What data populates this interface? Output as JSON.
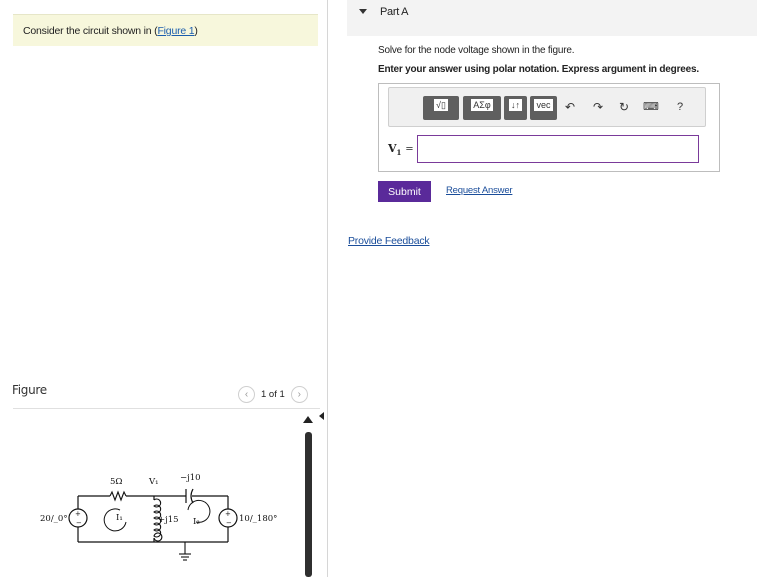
{
  "intro": {
    "text_prefix": "Consider the circuit shown in (",
    "figure_link": "Figure 1",
    "text_suffix": ")"
  },
  "figure": {
    "title": "Figure",
    "pager": "1 of 1",
    "prev_icon": "chevron-left-icon",
    "next_icon": "chevron-right-icon"
  },
  "circuit": {
    "source_left": "20/_0°",
    "resistor": "5Ω",
    "node": "V₁",
    "capacitor": "−j10",
    "inductor": "+j15",
    "mesh1": "I₁",
    "mesh2": "I₂",
    "source_right": "10/_180°"
  },
  "part": {
    "title": "Part A",
    "question": "Solve for the node voltage shown in the figure.",
    "instruction": "Enter your answer using polar notation. Express argument in degrees."
  },
  "toolbar": {
    "templates_label": "√▯",
    "greek_label": "ΑΣφ",
    "arrows_label": "↓↑",
    "vec_label": "vec",
    "undo_icon": "undo-icon",
    "redo_icon": "redo-icon",
    "reset_icon": "reset-icon",
    "keyboard_icon": "keyboard-icon",
    "help_label": "?"
  },
  "answer": {
    "variable": "V",
    "subscript": "1",
    "equals": "=",
    "value": ""
  },
  "actions": {
    "submit_label": "Submit",
    "request_label": "Request Answer",
    "feedback_label": "Provide Feedback"
  },
  "colors": {
    "submit": "#5a2a9a",
    "link": "#1a4d9a",
    "intro_bg": "#f7f7dc"
  }
}
